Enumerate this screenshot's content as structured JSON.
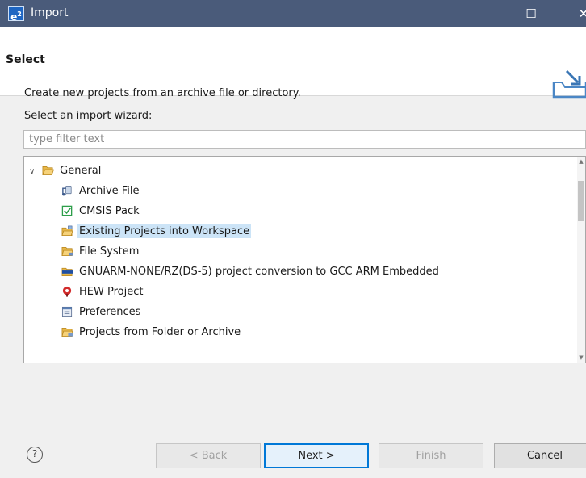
{
  "window": {
    "title": "Import",
    "logo_text": "e",
    "logo_sup": "2",
    "maximize_glyph": "☐",
    "close_glyph": "✕"
  },
  "header": {
    "title": "Select",
    "description": "Create new projects from an archive file or directory."
  },
  "wizard": {
    "select_label": "Select an import wizard:",
    "filter_placeholder": "type filter text",
    "tree": {
      "group": {
        "label": "General",
        "expanded": true,
        "icon": "folder-open-icon"
      },
      "items": [
        {
          "label": "Archive File",
          "icon": "archive-file-icon"
        },
        {
          "label": "CMSIS Pack",
          "icon": "cmsis-pack-icon"
        },
        {
          "label": "Existing Projects into Workspace",
          "icon": "existing-projects-icon",
          "selected": true
        },
        {
          "label": "File System",
          "icon": "file-system-folder-icon"
        },
        {
          "label": "GNUARM-NONE/RZ(DS-5)  project conversion to GCC ARM Embedded",
          "icon": "project-conversion-icon"
        },
        {
          "label": "HEW Project",
          "icon": "hew-project-icon"
        },
        {
          "label": "Preferences",
          "icon": "preferences-icon"
        },
        {
          "label": "Projects from Folder or Archive",
          "icon": "projects-folder-icon"
        }
      ]
    }
  },
  "footer": {
    "help_glyph": "?",
    "back_label": "< Back",
    "next_label": "Next >",
    "finish_label": "Finish",
    "cancel_label": "Cancel"
  },
  "colors": {
    "titlebar": "#4a5b7a",
    "selection": "#cce4f7",
    "default_button_border": "#0078d7"
  }
}
